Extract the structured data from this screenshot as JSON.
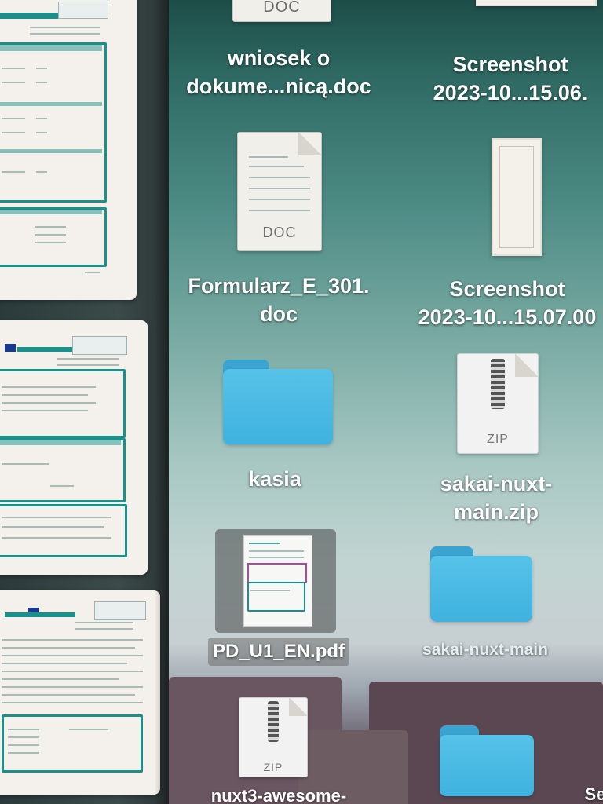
{
  "preview_pages": [
    {
      "id": "page-1"
    },
    {
      "id": "page-2"
    },
    {
      "id": "page-3"
    }
  ],
  "desktop_icons": {
    "wniosek": {
      "type": "doc",
      "ext_label": "DOC",
      "label_lines": [
        "wniosek o",
        "dokume...nicą.doc"
      ]
    },
    "screenshot1": {
      "type": "screenshot",
      "label_lines": [
        "Screenshot",
        "2023-10...15.06."
      ]
    },
    "formularz": {
      "type": "doc",
      "ext_label": "DOC",
      "label_lines": [
        "Formularz_E_301.",
        "doc"
      ]
    },
    "screenshot2": {
      "type": "screenshot",
      "label_lines": [
        "Screenshot",
        "2023-10...15.07.00"
      ]
    },
    "kasia": {
      "type": "folder",
      "label_lines": [
        "kasia"
      ]
    },
    "sakai_zip": {
      "type": "zip",
      "ext_label": "ZIP",
      "label_lines": [
        "sakai-nuxt-",
        "main.zip"
      ]
    },
    "pd_u1": {
      "type": "pdf",
      "label_lines": [
        "PD_U1_EN.pdf"
      ],
      "selected": true
    },
    "sakai_folder": {
      "type": "folder",
      "label_lines": [
        "sakai-nuxt-main"
      ]
    },
    "nuxt3_zip": {
      "type": "zip",
      "ext_label": "ZIP",
      "label_lines": [
        "nuxt3-awesome-"
      ]
    },
    "folder_bottom": {
      "type": "folder",
      "label_lines": [
        "Se"
      ]
    }
  },
  "colors": {
    "folder_blue": "#3fb2df",
    "form_teal": "#1b8f8a",
    "label_white": "#ffffff"
  }
}
